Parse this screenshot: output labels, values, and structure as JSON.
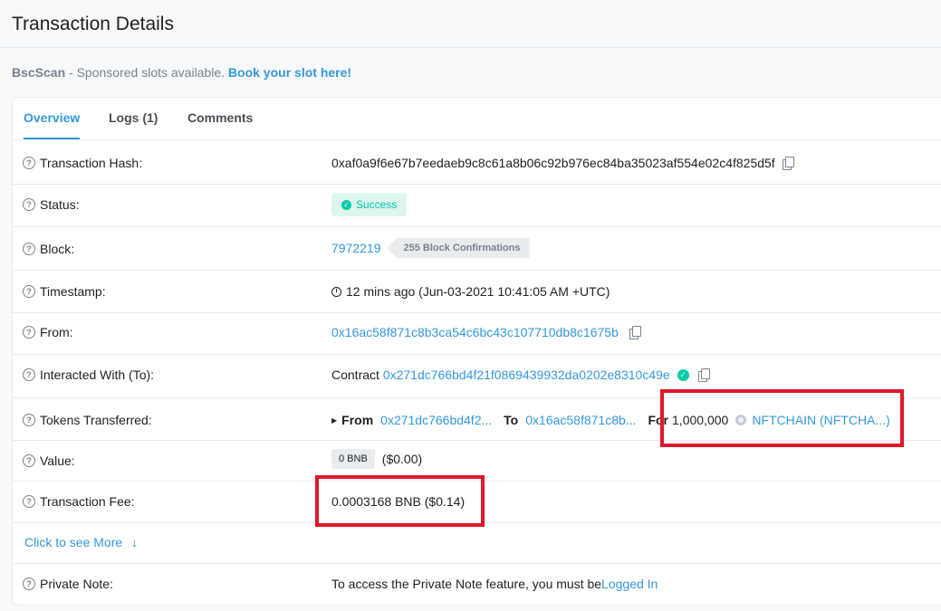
{
  "page": {
    "title": "Transaction Details"
  },
  "sponsor": {
    "brand": "BscScan",
    "text": " - Sponsored slots available. ",
    "cta": "Book your slot here!"
  },
  "tabs": [
    {
      "label": "Overview",
      "active": true
    },
    {
      "label": "Logs (1)",
      "active": false
    },
    {
      "label": "Comments",
      "active": false
    }
  ],
  "details": {
    "tx_hash": {
      "label": "Transaction Hash:",
      "value": "0xaf0a9f6e67b7eedaeb9c8c61a8b06c92b976ec84ba35023af554e02c4f825d5f"
    },
    "status": {
      "label": "Status:",
      "value": "Success"
    },
    "block": {
      "label": "Block:",
      "number": "7972219",
      "confirmations": "255 Block Confirmations"
    },
    "timestamp": {
      "label": "Timestamp:",
      "value": "12 mins ago (Jun-03-2021 10:41:05 AM +UTC)"
    },
    "from": {
      "label": "From:",
      "value": "0x16ac58f871c8b3ca54c6bc43c107710db8c1675b"
    },
    "interacted": {
      "label": "Interacted With (To):",
      "prefix": "Contract",
      "value": "0x271dc766bd4f21f0869439932da0202e8310c49e"
    },
    "tokens": {
      "label": "Tokens Transferred:",
      "from_label": "From",
      "from_value": "0x271dc766bd4f2...",
      "to_label": "To",
      "to_value": "0x16ac58f871c8b...",
      "for_label": "For",
      "amount": "1,000,000",
      "token": "NFTCHAIN (NFTCHA...)"
    },
    "value": {
      "label": "Value:",
      "badge": "0 BNB",
      "usd": "($0.00)"
    },
    "fee": {
      "label": "Transaction Fee:",
      "value": "0.0003168 BNB ($0.14)"
    },
    "see_more": "Click to see More",
    "private_note": {
      "label": "Private Note:",
      "text": "To access the Private Note feature, you must be ",
      "link": "Logged In"
    }
  },
  "colors": {
    "link": "#3498db",
    "success": "#00c9a7",
    "highlight": "#e0192b"
  },
  "icons": [
    "question-icon",
    "copy-icon",
    "check-circle-icon",
    "clock-icon",
    "verified-icon",
    "caret-right-icon",
    "token-logo",
    "arrow-down-icon"
  ]
}
